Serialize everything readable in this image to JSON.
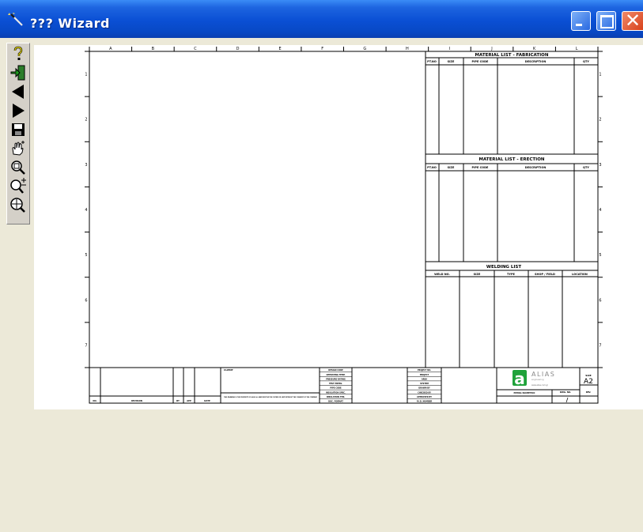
{
  "window": {
    "title": "??? Wizard",
    "icon": "wizard-wand-icon"
  },
  "toolbar": {
    "buttons": [
      {
        "name": "help-icon"
      },
      {
        "name": "exit-icon"
      },
      {
        "name": "back-arrow-icon"
      },
      {
        "name": "forward-arrow-icon"
      },
      {
        "name": "save-icon"
      },
      {
        "name": "pan-hand-icon"
      },
      {
        "name": "zoom-fit-icon"
      },
      {
        "name": "zoom-in-out-icon"
      },
      {
        "name": "zoom-window-icon"
      }
    ]
  },
  "drawing": {
    "column_letters": [
      "A",
      "B",
      "C",
      "D",
      "E",
      "F",
      "G",
      "H",
      "I",
      "J",
      "K",
      "L"
    ],
    "row_numbers": [
      "1",
      "2",
      "3",
      "4",
      "5",
      "6",
      "7"
    ],
    "fabrication": {
      "title": "MATERIAL LIST - FABRICATION",
      "headers": [
        "PT.NO",
        "SIZE",
        "PIPE CODE",
        "DESCRIPTION",
        "QTY"
      ]
    },
    "erection": {
      "title": "MATERIAL LIST - ERECTION",
      "headers": [
        "PT.NO",
        "SIZE",
        "PIPE CODE",
        "DESCRIPTION",
        "QTY"
      ]
    },
    "welding": {
      "title": "WELDING LIST",
      "headers": [
        "WELD NO.",
        "SIZE",
        "TYPE",
        "SHOP / FIELD",
        "LOCATION"
      ]
    },
    "title_block": {
      "revision_headers": [
        "NO.",
        "REVISION",
        "BY",
        "APP",
        "DATE"
      ],
      "client_label": "CLIENT",
      "note": "THIS DRAWING IS THE PROPERTY OF ALIA S.A. AND MUST NOT BE COPIED OR LENT WITHOUT THE CONSENT OF THE COMPANY",
      "left_fields": [
        "DESIGN CODE",
        "OPERATING TEMP.",
        "PRESSURE RATING",
        "TEST PRESS.",
        "PIPE CODE",
        "INSULATION SPEC.",
        "INSULATION THK.",
        "DOC. FORMAT"
      ],
      "right_fields": [
        "PROJECT NO.",
        "PROJECT",
        "AREA",
        "SYSTEM",
        "DRAWN BY",
        "CHECKED BY",
        "APPROVED BY",
        "P.I.D. NUMBER"
      ],
      "company": "ALIAS",
      "company_sub": "engineering",
      "company_site": "www.alias.com.gr",
      "doc_label": "PIPING ISOMETRIC",
      "size_label": "SIZE",
      "size_value": "A2",
      "dwg_label": "DWG. NO.",
      "rev_label": "REV."
    }
  }
}
